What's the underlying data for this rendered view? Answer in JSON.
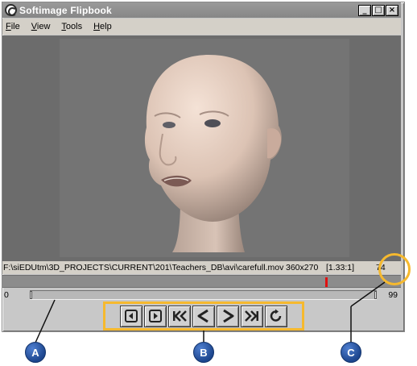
{
  "window": {
    "title": "Softimage Flipbook",
    "controls": {
      "minimize": "_",
      "maximize": "□",
      "close": "×"
    }
  },
  "menu": [
    {
      "label": "File",
      "mnemonic": "F",
      "rest": "ile"
    },
    {
      "label": "View",
      "mnemonic": "V",
      "rest": "iew"
    },
    {
      "label": "Tools",
      "mnemonic": "T",
      "rest": "ools"
    },
    {
      "label": "Help",
      "mnemonic": "H",
      "rest": "elp"
    }
  ],
  "status": {
    "path": "F:\\siEDUtm\\3D_PROJECTS\\CURRENT\\201\\Teachers_DB\\avi\\carefull.mov",
    "resolution": "360x270",
    "aspect": "[1.33:1]",
    "frame": "74"
  },
  "timeline": {
    "current_frame": 74,
    "range_start": "0",
    "range_end": "99"
  },
  "playback_controls": [
    {
      "name": "previous-frame",
      "icon": "prev-frame-icon"
    },
    {
      "name": "next-frame",
      "icon": "next-frame-icon"
    },
    {
      "name": "go-to-start",
      "icon": "go-to-start-icon"
    },
    {
      "name": "play-backward",
      "icon": "play-backward-icon"
    },
    {
      "name": "play-forward",
      "icon": "play-forward-icon"
    },
    {
      "name": "go-to-end",
      "icon": "go-to-end-icon"
    },
    {
      "name": "loop",
      "icon": "loop-icon"
    }
  ],
  "callouts": {
    "a": "A",
    "b": "B",
    "c": "C"
  },
  "colors": {
    "callout": "#f6b92e",
    "badge": "#1d468e",
    "playhead": "#e01010"
  }
}
